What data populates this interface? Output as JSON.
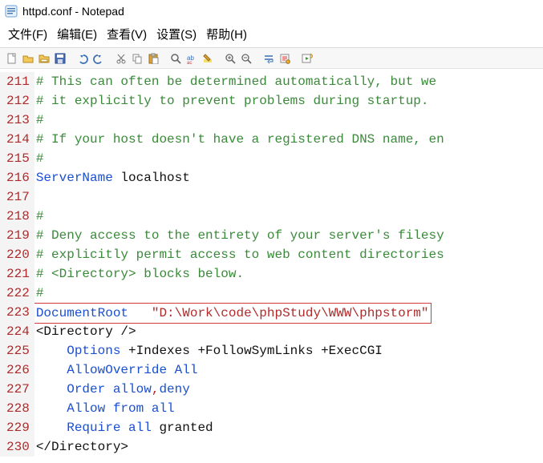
{
  "window": {
    "title": "httpd.conf - Notepad"
  },
  "menu": {
    "file": "文件(F)",
    "edit": "编辑(E)",
    "view": "查看(V)",
    "settings": "设置(S)",
    "help": "帮助(H)"
  },
  "lines": [
    {
      "n": 211,
      "type": "comment",
      "text": "# This can often be determined automatically, but we "
    },
    {
      "n": 212,
      "type": "comment",
      "text": "# it explicitly to prevent problems during startup."
    },
    {
      "n": 213,
      "type": "comment",
      "text": "#"
    },
    {
      "n": 214,
      "type": "comment",
      "text": "# If your host doesn't have a registered DNS name, en"
    },
    {
      "n": 215,
      "type": "comment",
      "text": "#"
    },
    {
      "n": 216,
      "type": "directive",
      "key": "ServerName",
      "val": "localhost"
    },
    {
      "n": 217,
      "type": "blank",
      "text": ""
    },
    {
      "n": 218,
      "type": "comment",
      "text": "#"
    },
    {
      "n": 219,
      "type": "comment",
      "text": "# Deny access to the entirety of your server's filesy"
    },
    {
      "n": 220,
      "type": "comment",
      "text": "# explicitly permit access to web content directories"
    },
    {
      "n": 221,
      "type": "comment",
      "text": "# <Directory> blocks below."
    },
    {
      "n": 222,
      "type": "comment",
      "text": "#"
    },
    {
      "n": 223,
      "type": "docroot",
      "key": "DocumentRoot",
      "val": "\"D:\\Work\\code\\phpStudy\\WWW\\phpstorm\""
    },
    {
      "n": 224,
      "type": "tagopen",
      "text": "<Directory />"
    },
    {
      "n": 225,
      "type": "opt",
      "indent": "    ",
      "key": "Options",
      "rest": " +Indexes +FollowSymLinks +ExecCGI"
    },
    {
      "n": 226,
      "type": "kv",
      "indent": "    ",
      "key": "AllowOverride",
      "val": "All"
    },
    {
      "n": 227,
      "type": "order",
      "indent": "    ",
      "key": "Order",
      "a": "allow",
      "b": "deny"
    },
    {
      "n": 228,
      "type": "kv",
      "indent": "    ",
      "key": "Allow",
      "val": "from all"
    },
    {
      "n": 229,
      "type": "req",
      "indent": "    ",
      "key": "Require",
      "a": "all",
      "b": "granted"
    },
    {
      "n": 230,
      "type": "tagclose",
      "text": "</Directory>"
    }
  ]
}
